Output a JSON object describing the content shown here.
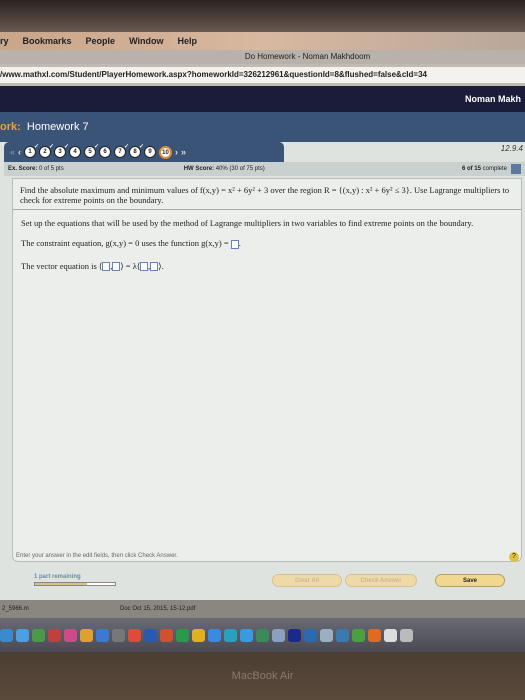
{
  "menubar": {
    "items": [
      "ry",
      "Bookmarks",
      "People",
      "Window",
      "Help"
    ]
  },
  "window_title": "Do Homework - Noman Makhdoom",
  "url": "/www.mathxl.com/Student/PlayerHomework.aspx?homeworkId=326212961&questionId=8&flushed=false&cId=34",
  "user_name": "Noman Makh",
  "homework": {
    "label": "ork:",
    "title": "Homework 7"
  },
  "question_nav": {
    "questions": [
      {
        "n": "1",
        "done": true
      },
      {
        "n": "2",
        "done": true
      },
      {
        "n": "3",
        "done": true
      },
      {
        "n": "4",
        "done": false
      },
      {
        "n": "5",
        "done": true
      },
      {
        "n": "6",
        "done": false
      },
      {
        "n": "7",
        "done": true
      },
      {
        "n": "8",
        "done": true
      },
      {
        "n": "9",
        "done": false
      },
      {
        "n": "10",
        "current": true
      }
    ],
    "first": "«",
    "prev": "‹",
    "next": "›",
    "last": "»"
  },
  "section_id": "12.9.4",
  "scores": {
    "ex_label": "Ex. Score:",
    "ex_value": "0 of 5 pts",
    "hw_label": "HW Score:",
    "hw_value": "40% (30 of 75 pts)",
    "complete_bold": "6 of 15",
    "complete_text": "complete"
  },
  "problem": {
    "text": "Find the absolute maximum and minimum values of f(x,y) = x² + 6y² + 3 over the region R = {(x,y) : x² + 6y² ≤ 3}. Use Lagrange multipliers to check for extreme points on the boundary."
  },
  "instructions": "Set up the equations that will be used by the method of Lagrange multipliers in two variables to find extreme points on the boundary.",
  "constraint": {
    "text": "The constraint equation, g(x,y) = 0 uses the function g(x,y) =",
    "value": ""
  },
  "vector": {
    "text": "The vector equation is",
    "lambda": "= λ"
  },
  "hint": "Enter your answer in the edit fields, then click Check Answer.",
  "help": "?",
  "progress": {
    "label": "1 part remaining",
    "fraction": 0.65
  },
  "buttons": {
    "clear": "Clear All",
    "check": "Check Answer",
    "save": "Save"
  },
  "downloads": {
    "item1": "2_5966.m",
    "item2": "Doc Oct 15, 2015, 15-12.pdf"
  },
  "dock": {
    "icons": [
      "finder",
      "messages",
      "facetime",
      "photo-booth",
      "itunes",
      "ibooks",
      "app-store",
      "system-preferences",
      "chrome",
      "word",
      "powerpoint",
      "excel",
      "outlook",
      "safari",
      "c-app",
      "skype",
      "vpn",
      "preview",
      "league-of-legends",
      "teamviewer",
      "scanner",
      "xcode",
      "utorrent",
      "matlab",
      "document",
      "trash"
    ]
  },
  "bezel_label": "MacBook Air"
}
